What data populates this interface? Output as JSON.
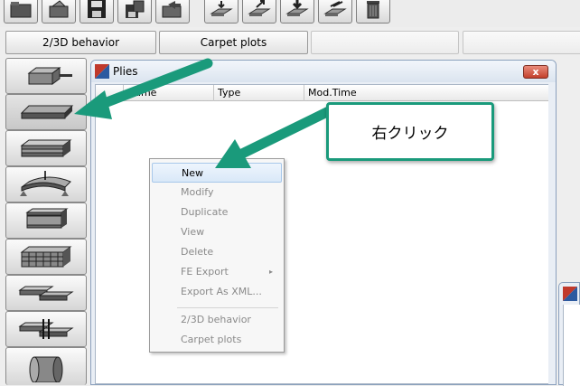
{
  "toolbar": {
    "icons": [
      "folder-icon",
      "open-folder-icon",
      "save-icon",
      "save-as-icon",
      "folder-arrow-icon",
      "import-plate-icon",
      "export-plate-icon",
      "download-plate-icon",
      "copy-plate-icon",
      "trash-icon"
    ]
  },
  "tabs": {
    "behavior_label": "2/3D behavior",
    "carpet_label": "Carpet plots",
    "empty1": "",
    "empty2": ""
  },
  "palette": {
    "items": [
      "bar-element-icon",
      "ply-plate-icon",
      "laminate-icon",
      "loaded-panel-icon",
      "i-beam-icon",
      "grid-panel-icon",
      "bonded-joint-icon",
      "bolted-joint-icon",
      "cylinder-icon"
    ]
  },
  "plies_window": {
    "title": "Plies",
    "close_symbol": "x",
    "columns": [
      "Name",
      "Type",
      "Mod.Time"
    ]
  },
  "context_menu": {
    "items": [
      {
        "label": "New",
        "enabled": true
      },
      {
        "label": "Modify",
        "enabled": false
      },
      {
        "label": "Duplicate",
        "enabled": false
      },
      {
        "label": "View",
        "enabled": false
      },
      {
        "label": "Delete",
        "enabled": false
      },
      {
        "label": "FE Export",
        "enabled": false,
        "submenu_arrow": "▸"
      },
      {
        "label": "Export As XML...",
        "enabled": false
      },
      {
        "label": "2/3D behavior",
        "enabled": false
      },
      {
        "label": "Carpet plots",
        "enabled": false
      }
    ]
  },
  "annotation": {
    "callout_text": "右クリック",
    "accent_color": "#1a9a7b"
  }
}
